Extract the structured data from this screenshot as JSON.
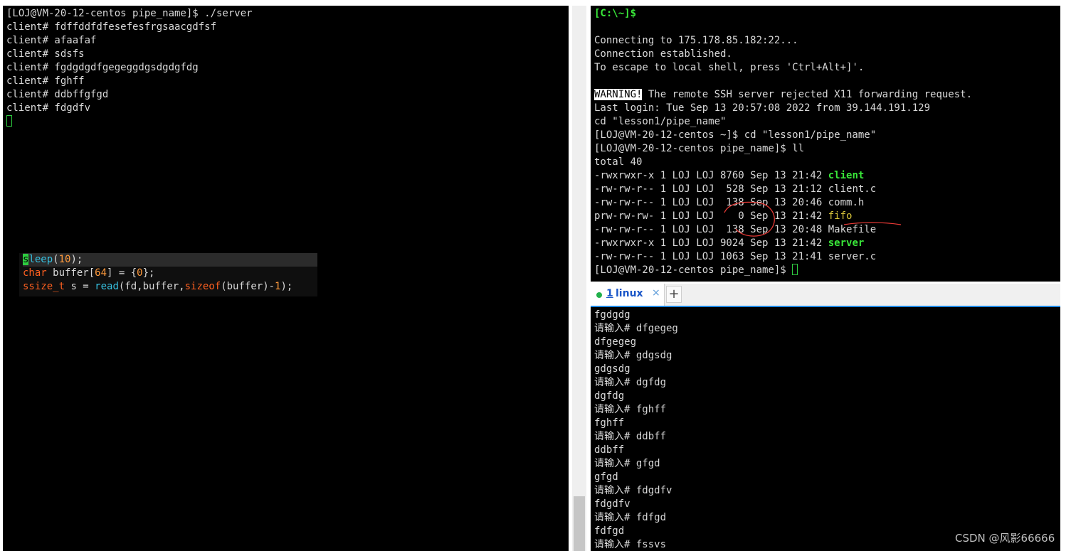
{
  "left_terminal": {
    "lines": [
      "[LOJ@VM-20-12-centos pipe_name]$ ./server",
      "client# fdffddfdfesefesfrgsaacgdfsf",
      "client# afaafaf",
      "client# sdsfs",
      "client# fgdgdgdfgegeggdgsdgdgfdg",
      "client# fghff",
      "client# ddbffgfgd",
      "client# fdgdfv"
    ]
  },
  "code_popup": {
    "line1": {
      "cursor": "s",
      "rest": "leep",
      "open": "(",
      "num": "10",
      "close": ");"
    },
    "line2": {
      "kw": "char",
      "mid": " buffer[",
      "num1": "64",
      "mid2": "] = {",
      "num2": "0",
      "end": "};"
    },
    "line3": {
      "type": "ssize_t",
      "mid": " s = ",
      "fn": "read",
      "args": "(fd,buffer,",
      "kw": "sizeof",
      "args2": "(buffer)-",
      "num": "1",
      "end": ");"
    }
  },
  "right_top_terminal": {
    "prompt": "[C:\\~]$",
    "lines_a": [
      "Connecting to 175.178.85.182:22...",
      "Connection established.",
      "To escape to local shell, press 'Ctrl+Alt+]'."
    ],
    "warning_label": "WARNING!",
    "warning_text": " The remote SSH server rejected X11 forwarding request.",
    "lines_b": [
      "Last login: Tue Sep 13 20:57:08 2022 from 39.144.191.129",
      "cd \"lesson1/pipe_name\"",
      "[LOJ@VM-20-12-centos ~]$ cd \"lesson1/pipe_name\"",
      "[LOJ@VM-20-12-centos pipe_name]$ ll",
      "total 40"
    ],
    "files": [
      {
        "meta": "-rwxrwxr-x 1 LOJ LOJ 8760 Sep 13 21:42 ",
        "name": "client",
        "style": "exec"
      },
      {
        "meta": "-rw-rw-r-- 1 LOJ LOJ  528 Sep 13 21:12 ",
        "name": "client.c",
        "style": "plain"
      },
      {
        "meta": "-rw-rw-r-- 1 LOJ LOJ  138 Sep 13 20:46 ",
        "name": "comm.h",
        "style": "plain"
      },
      {
        "meta": "prw-rw-rw- 1 LOJ LOJ    0 Sep 13 21:42 ",
        "name": "fifo",
        "style": "pipe"
      },
      {
        "meta": "-rw-rw-r-- 1 LOJ LOJ  138 Sep 13 20:48 ",
        "name": "Makefile",
        "style": "plain"
      },
      {
        "meta": "-rwxrwxr-x 1 LOJ LOJ 9024 Sep 13 21:42 ",
        "name": "server",
        "style": "exec"
      },
      {
        "meta": "-rw-rw-r-- 1 LOJ LOJ 1063 Sep 13 21:41 ",
        "name": "server.c",
        "style": "plain"
      }
    ],
    "last_prompt": "[LOJ@VM-20-12-centos pipe_name]$ "
  },
  "tabbar": {
    "tab_number": "1",
    "tab_label": " linux",
    "close_glyph": "×",
    "add_glyph": "+"
  },
  "right_bottom_terminal": {
    "lines": [
      "fgdgdg",
      "请输入# dfgegeg",
      "dfgegeg",
      "请输入# gdgsdg",
      "gdgsdg",
      "请输入# dgfdg",
      "dgfdg",
      "请输入# fghff",
      "fghff",
      "请输入# ddbff",
      "ddbff",
      "请输入# gfgd",
      "gfgd",
      "请输入# fdgdfv",
      "fdgdfv",
      "请输入# fdfgd",
      "fdfgd",
      "请输入# fssvs"
    ]
  },
  "watermark": "CSDN @风影66666",
  "colors": {
    "terminal_bg": "#000000",
    "text": "#d8d8d8",
    "exec_green": "#39e639",
    "pipe_yellow": "#d7c43a",
    "tab_accent": "#1e88e5",
    "annotation_red": "#e53935"
  }
}
